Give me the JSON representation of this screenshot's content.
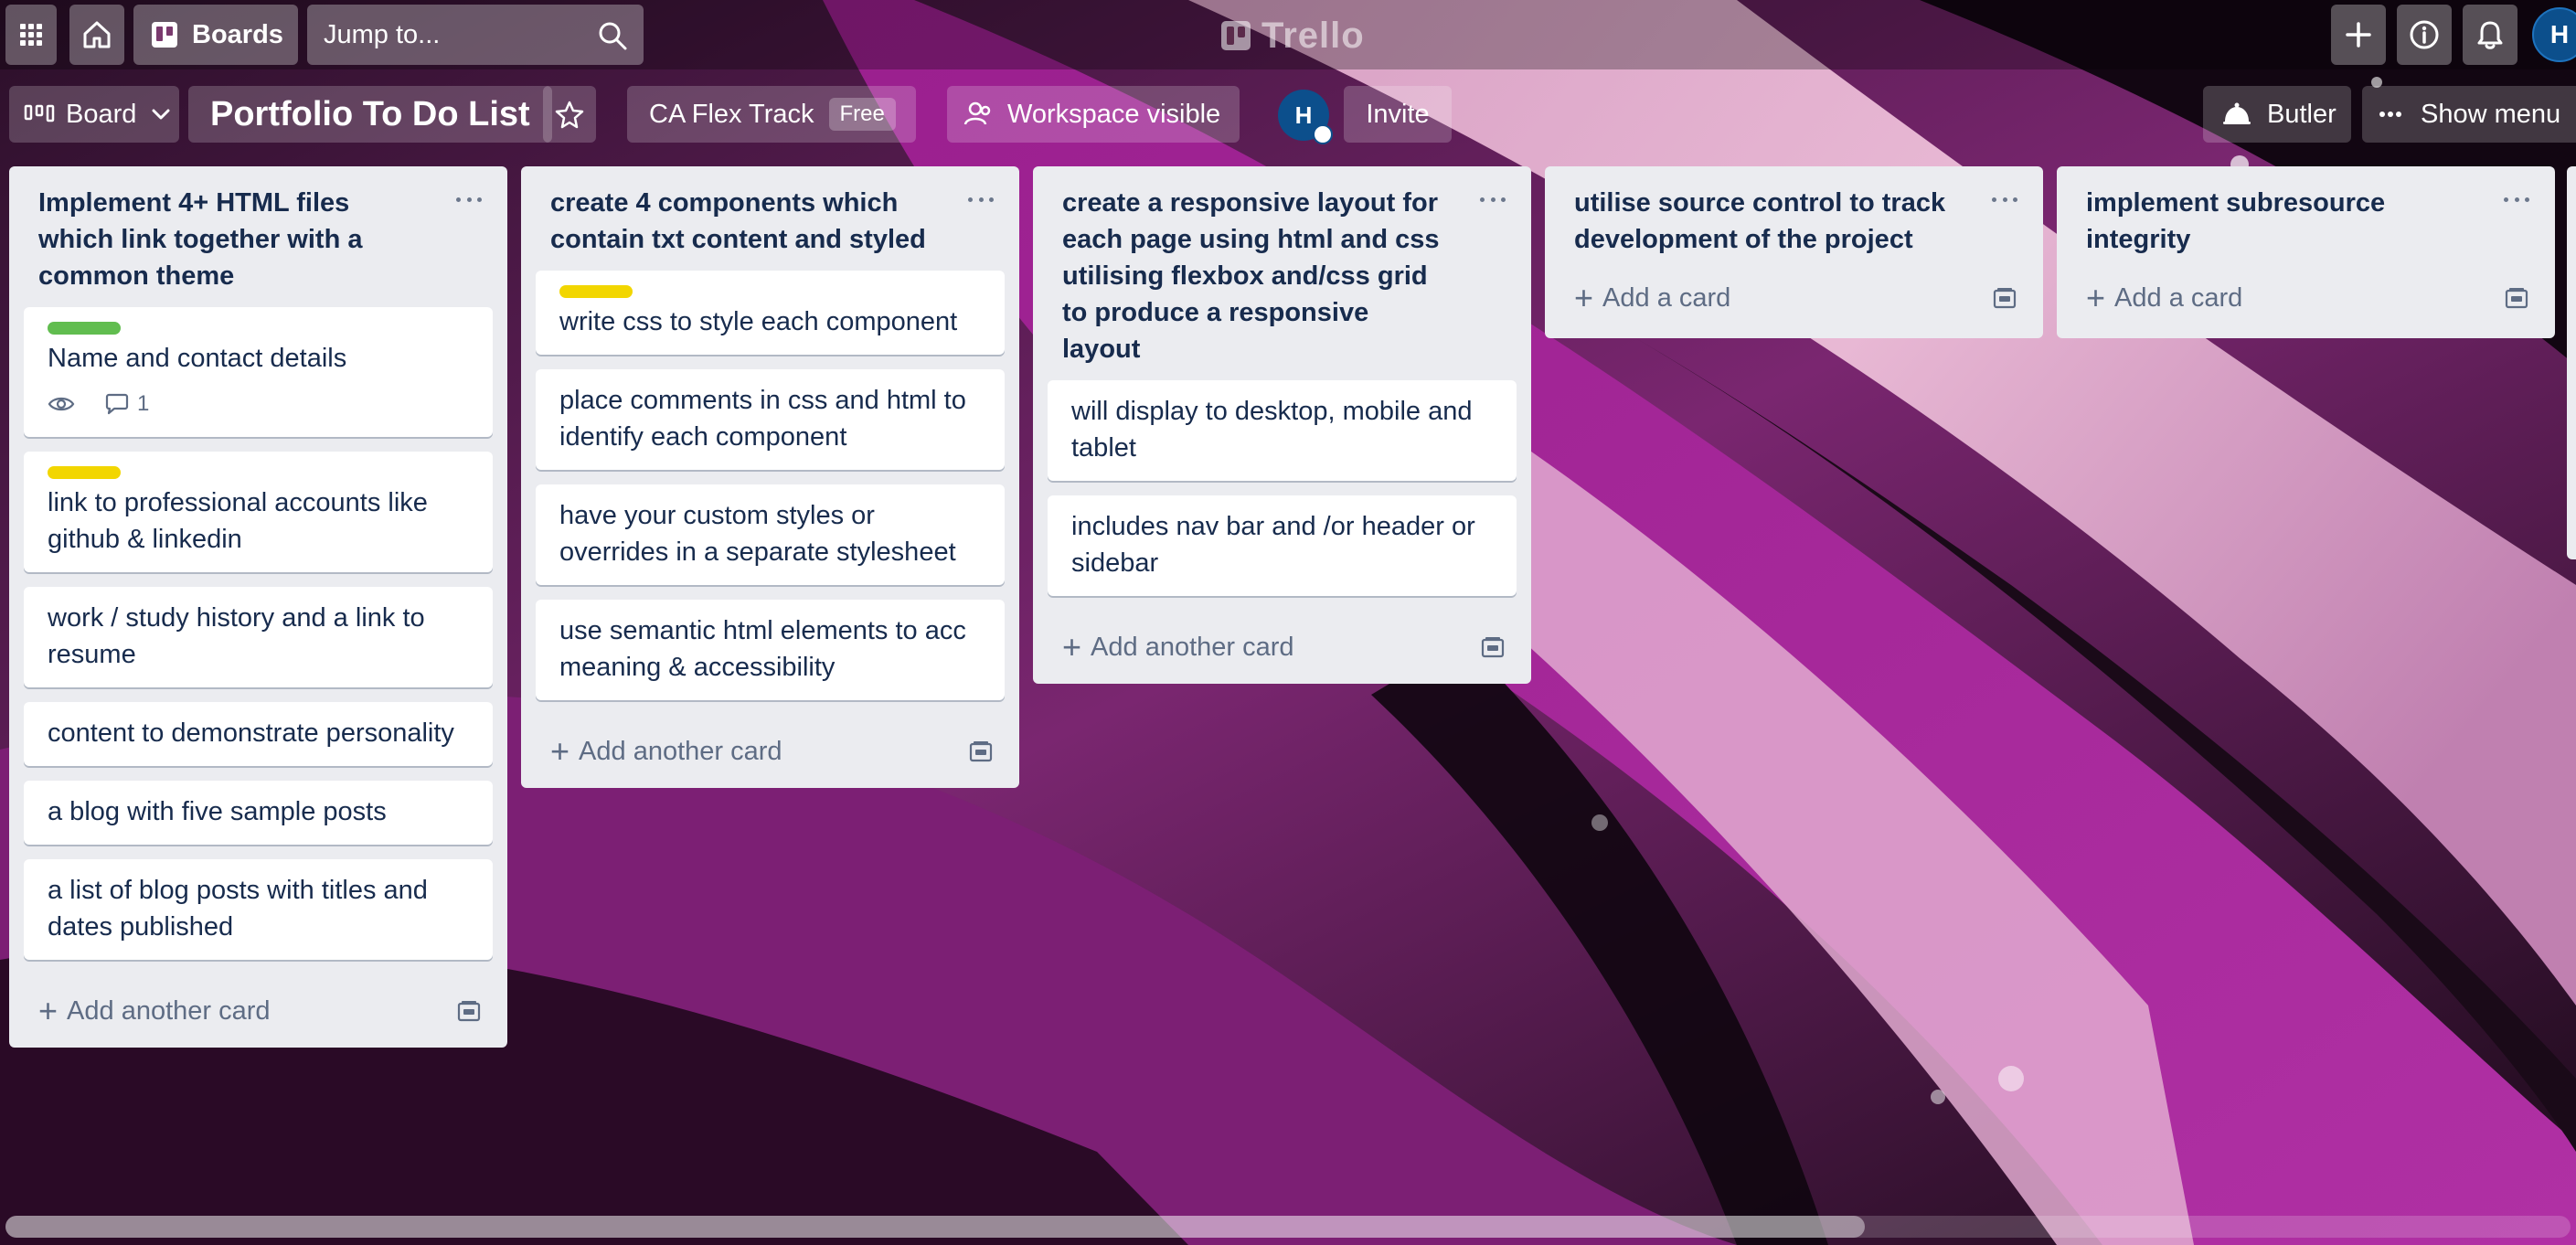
{
  "topnav": {
    "boards_label": "Boards",
    "search_placeholder": "Jump to...",
    "logo_text": "Trello",
    "user_initial": "H"
  },
  "board_header": {
    "view_label": "Board",
    "title": "Portfolio To Do List",
    "workspace_name": "CA Flex Track",
    "workspace_badge": "Free",
    "visibility_label": "Workspace visible",
    "member_initial": "H",
    "invite_label": "Invite",
    "butler_label": "Butler",
    "show_menu_label": "Show menu"
  },
  "lists": [
    {
      "title": "Implement 4+ HTML files which link together with a common theme",
      "cards": [
        {
          "label_color": "#61bd4f",
          "text": "Name and contact details",
          "watch": true,
          "comments": "1"
        },
        {
          "label_color": "#f2d600",
          "text": "link to professional accounts like github & linkedin"
        },
        {
          "text": "work / study history and a link to resume"
        },
        {
          "text": "content to demonstrate personality"
        },
        {
          "text": "a blog with five sample posts"
        },
        {
          "text": "a list of blog posts with titles and dates published"
        }
      ],
      "add_label": "Add another card"
    },
    {
      "title": "create 4 components which contain txt content and styled",
      "cards": [
        {
          "label_color": "#f2d600",
          "text": "write css to style each component"
        },
        {
          "text": "place comments in css and html to identify each component"
        },
        {
          "text": "have your custom styles or overrides in a separate stylesheet"
        },
        {
          "text": "use semantic html elements to acc meaning & accessibility"
        }
      ],
      "add_label": "Add another card"
    },
    {
      "title": "create a responsive layout for each page using html and css utilising flexbox and/css grid to produce a responsive layout",
      "cards": [
        {
          "text": "will display to desktop, mobile and tablet"
        },
        {
          "text": "includes nav bar and /or header or sidebar"
        }
      ],
      "add_label": "Add another card"
    },
    {
      "title": "utilise source control to track development of the project",
      "cards": [],
      "add_label": "Add a card"
    },
    {
      "title": "implement subresource integrity",
      "cards": [],
      "add_label": "Add a card"
    }
  ],
  "colors": {
    "list_bg": "#ebecf0",
    "card_text": "#172b4d",
    "muted_text": "#5e6c84",
    "avatar_blue": "#0c4f8c"
  }
}
